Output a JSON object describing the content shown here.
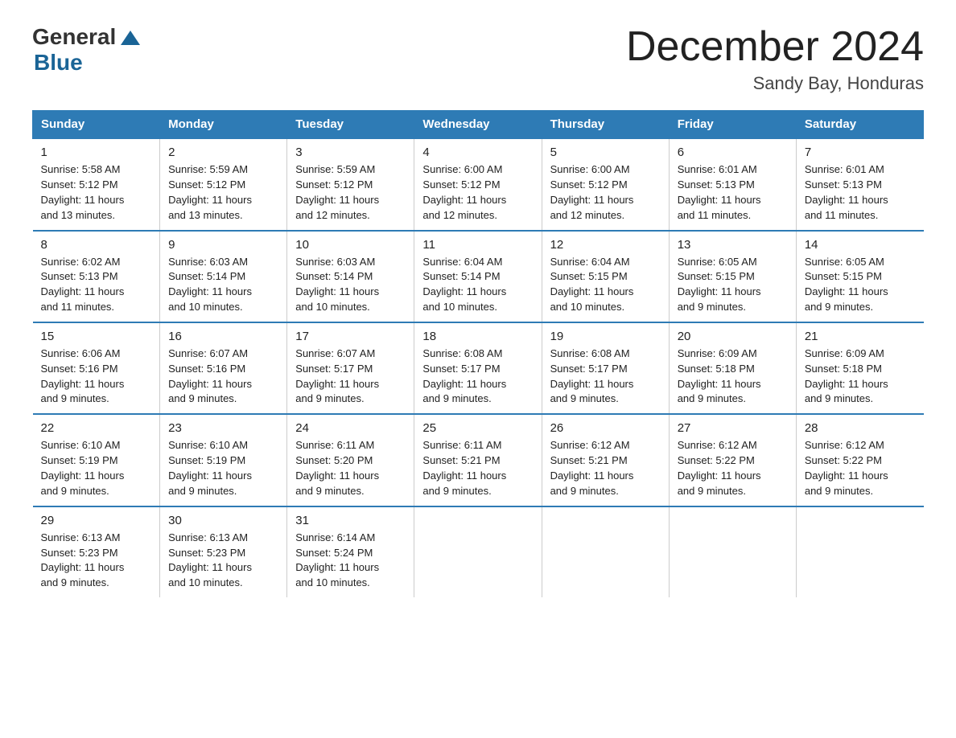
{
  "logo": {
    "general": "General",
    "blue": "Blue"
  },
  "title": "December 2024",
  "subtitle": "Sandy Bay, Honduras",
  "days_of_week": [
    "Sunday",
    "Monday",
    "Tuesday",
    "Wednesday",
    "Thursday",
    "Friday",
    "Saturday"
  ],
  "weeks": [
    [
      {
        "day": "1",
        "info": "Sunrise: 5:58 AM\nSunset: 5:12 PM\nDaylight: 11 hours\nand 13 minutes."
      },
      {
        "day": "2",
        "info": "Sunrise: 5:59 AM\nSunset: 5:12 PM\nDaylight: 11 hours\nand 13 minutes."
      },
      {
        "day": "3",
        "info": "Sunrise: 5:59 AM\nSunset: 5:12 PM\nDaylight: 11 hours\nand 12 minutes."
      },
      {
        "day": "4",
        "info": "Sunrise: 6:00 AM\nSunset: 5:12 PM\nDaylight: 11 hours\nand 12 minutes."
      },
      {
        "day": "5",
        "info": "Sunrise: 6:00 AM\nSunset: 5:12 PM\nDaylight: 11 hours\nand 12 minutes."
      },
      {
        "day": "6",
        "info": "Sunrise: 6:01 AM\nSunset: 5:13 PM\nDaylight: 11 hours\nand 11 minutes."
      },
      {
        "day": "7",
        "info": "Sunrise: 6:01 AM\nSunset: 5:13 PM\nDaylight: 11 hours\nand 11 minutes."
      }
    ],
    [
      {
        "day": "8",
        "info": "Sunrise: 6:02 AM\nSunset: 5:13 PM\nDaylight: 11 hours\nand 11 minutes."
      },
      {
        "day": "9",
        "info": "Sunrise: 6:03 AM\nSunset: 5:14 PM\nDaylight: 11 hours\nand 10 minutes."
      },
      {
        "day": "10",
        "info": "Sunrise: 6:03 AM\nSunset: 5:14 PM\nDaylight: 11 hours\nand 10 minutes."
      },
      {
        "day": "11",
        "info": "Sunrise: 6:04 AM\nSunset: 5:14 PM\nDaylight: 11 hours\nand 10 minutes."
      },
      {
        "day": "12",
        "info": "Sunrise: 6:04 AM\nSunset: 5:15 PM\nDaylight: 11 hours\nand 10 minutes."
      },
      {
        "day": "13",
        "info": "Sunrise: 6:05 AM\nSunset: 5:15 PM\nDaylight: 11 hours\nand 9 minutes."
      },
      {
        "day": "14",
        "info": "Sunrise: 6:05 AM\nSunset: 5:15 PM\nDaylight: 11 hours\nand 9 minutes."
      }
    ],
    [
      {
        "day": "15",
        "info": "Sunrise: 6:06 AM\nSunset: 5:16 PM\nDaylight: 11 hours\nand 9 minutes."
      },
      {
        "day": "16",
        "info": "Sunrise: 6:07 AM\nSunset: 5:16 PM\nDaylight: 11 hours\nand 9 minutes."
      },
      {
        "day": "17",
        "info": "Sunrise: 6:07 AM\nSunset: 5:17 PM\nDaylight: 11 hours\nand 9 minutes."
      },
      {
        "day": "18",
        "info": "Sunrise: 6:08 AM\nSunset: 5:17 PM\nDaylight: 11 hours\nand 9 minutes."
      },
      {
        "day": "19",
        "info": "Sunrise: 6:08 AM\nSunset: 5:17 PM\nDaylight: 11 hours\nand 9 minutes."
      },
      {
        "day": "20",
        "info": "Sunrise: 6:09 AM\nSunset: 5:18 PM\nDaylight: 11 hours\nand 9 minutes."
      },
      {
        "day": "21",
        "info": "Sunrise: 6:09 AM\nSunset: 5:18 PM\nDaylight: 11 hours\nand 9 minutes."
      }
    ],
    [
      {
        "day": "22",
        "info": "Sunrise: 6:10 AM\nSunset: 5:19 PM\nDaylight: 11 hours\nand 9 minutes."
      },
      {
        "day": "23",
        "info": "Sunrise: 6:10 AM\nSunset: 5:19 PM\nDaylight: 11 hours\nand 9 minutes."
      },
      {
        "day": "24",
        "info": "Sunrise: 6:11 AM\nSunset: 5:20 PM\nDaylight: 11 hours\nand 9 minutes."
      },
      {
        "day": "25",
        "info": "Sunrise: 6:11 AM\nSunset: 5:21 PM\nDaylight: 11 hours\nand 9 minutes."
      },
      {
        "day": "26",
        "info": "Sunrise: 6:12 AM\nSunset: 5:21 PM\nDaylight: 11 hours\nand 9 minutes."
      },
      {
        "day": "27",
        "info": "Sunrise: 6:12 AM\nSunset: 5:22 PM\nDaylight: 11 hours\nand 9 minutes."
      },
      {
        "day": "28",
        "info": "Sunrise: 6:12 AM\nSunset: 5:22 PM\nDaylight: 11 hours\nand 9 minutes."
      }
    ],
    [
      {
        "day": "29",
        "info": "Sunrise: 6:13 AM\nSunset: 5:23 PM\nDaylight: 11 hours\nand 9 minutes."
      },
      {
        "day": "30",
        "info": "Sunrise: 6:13 AM\nSunset: 5:23 PM\nDaylight: 11 hours\nand 10 minutes."
      },
      {
        "day": "31",
        "info": "Sunrise: 6:14 AM\nSunset: 5:24 PM\nDaylight: 11 hours\nand 10 minutes."
      },
      {
        "day": "",
        "info": ""
      },
      {
        "day": "",
        "info": ""
      },
      {
        "day": "",
        "info": ""
      },
      {
        "day": "",
        "info": ""
      }
    ]
  ]
}
